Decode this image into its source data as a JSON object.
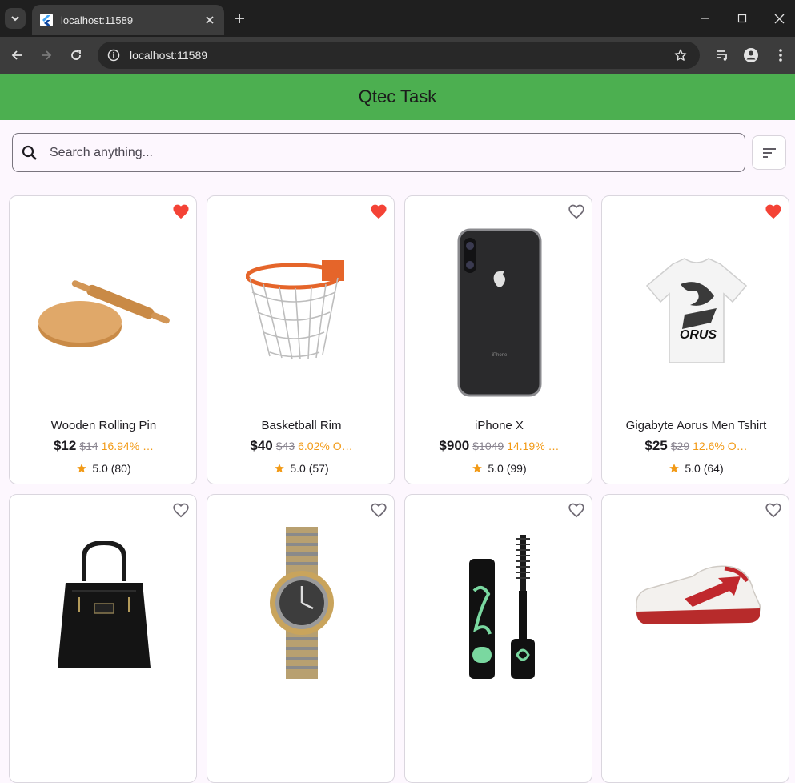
{
  "browser": {
    "tab_title": "localhost:11589",
    "url": "localhost:11589"
  },
  "app": {
    "title": "Qtec Task",
    "search_placeholder": "Search anything...",
    "accent": "#4caf50",
    "favorite_color": "#f44336",
    "discount_color": "#f29a16"
  },
  "products": [
    {
      "name": "Wooden Rolling Pin",
      "price": "$12",
      "old_price": "$14",
      "discount": "16.94% …",
      "rating": "5.0",
      "reviews": "(80)",
      "favorite": true,
      "image": "rolling-pin"
    },
    {
      "name": "Basketball Rim",
      "price": "$40",
      "old_price": "$43",
      "discount": "6.02% O…",
      "rating": "5.0",
      "reviews": "(57)",
      "favorite": true,
      "image": "basketball-rim"
    },
    {
      "name": "iPhone X",
      "price": "$900",
      "old_price": "$1049",
      "discount": "14.19% …",
      "rating": "5.0",
      "reviews": "(99)",
      "favorite": false,
      "image": "iphone"
    },
    {
      "name": "Gigabyte Aorus Men Tshirt",
      "price": "$25",
      "old_price": "$29",
      "discount": "12.6% O…",
      "rating": "5.0",
      "reviews": "(64)",
      "favorite": true,
      "image": "tshirt"
    },
    {
      "favorite": false,
      "image": "handbag"
    },
    {
      "favorite": false,
      "image": "watch"
    },
    {
      "favorite": false,
      "image": "mascara"
    },
    {
      "favorite": false,
      "image": "sneaker"
    }
  ]
}
